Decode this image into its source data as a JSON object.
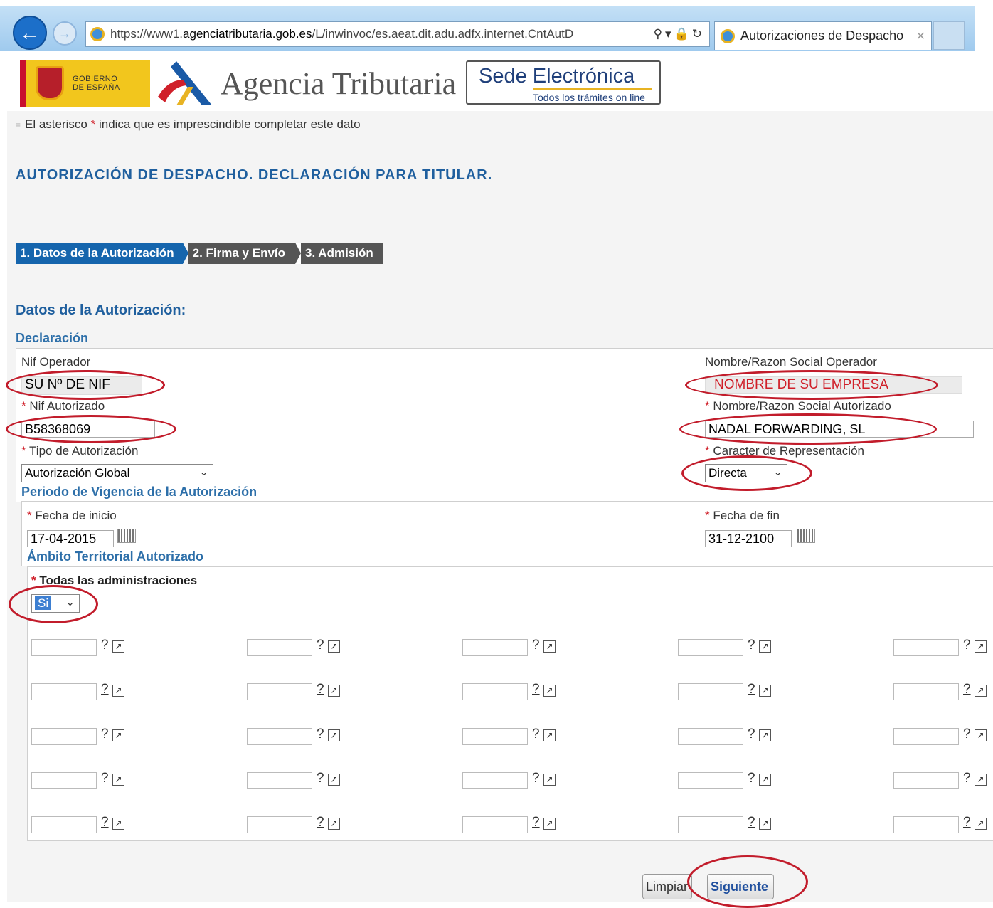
{
  "browser": {
    "url_prefix": "https://www1.",
    "url_domain": "agenciatributaria.gob.es",
    "url_rest": "/L/inwinvoc/es.aeat.dit.adu.adfx.internet.CntAutD",
    "tab_title": "Autorizaciones de Despacho"
  },
  "header": {
    "gov_line1": "GOBIERNO",
    "gov_line2": "DE ESPAÑA",
    "agency_name": "Agencia Tributaria",
    "sede_title": "Sede Electrónica",
    "sede_subtitle": "Todos los trámites on line"
  },
  "note": {
    "before": "El asterisco ",
    "star": "*",
    "after": " indica que es imprescindible completar este dato"
  },
  "page_title": "AUTORIZACIÓN DE DESPACHO. DECLARACIÓN PARA TITULAR.",
  "steps": [
    {
      "label": "1. Datos de la Autorización",
      "active": true
    },
    {
      "label": "2. Firma y Envío",
      "active": false
    },
    {
      "label": "3. Admisión",
      "active": false
    }
  ],
  "section_title": "Datos de la Autorización:",
  "declaracion": {
    "title": "Declaración",
    "nif_operador_label": "Nif Operador",
    "nif_operador_value": "SU Nº DE NIF",
    "nombre_operador_label": "Nombre/Razon Social Operador",
    "nombre_operador_value": "NOMBRE DE SU EMPRESA",
    "nif_autorizado_label": "Nif Autorizado",
    "nif_autorizado_value": "B58368069",
    "nombre_autorizado_label": "Nombre/Razon Social Autorizado",
    "nombre_autorizado_value": "NADAL FORWARDING, SL",
    "tipo_label": "Tipo de Autorización",
    "tipo_value": "Autorización Global",
    "caracter_label": "Caracter de Representación",
    "caracter_value": "Directa"
  },
  "periodo": {
    "title": "Periodo de Vigencia de la Autorización",
    "inicio_label": "Fecha de inicio",
    "inicio_value": "17-04-2015",
    "fin_label": "Fecha de fin",
    "fin_value": "31-12-2100"
  },
  "ambito": {
    "title": "Ámbito Territorial Autorizado",
    "todas_label": "Todas las administraciones",
    "todas_value": "Si",
    "help_glyph": "?",
    "popup_glyph": "↗"
  },
  "buttons": {
    "limpiar": "Limpiar",
    "siguiente": "Siguiente"
  },
  "colors": {
    "accent_blue": "#1f5f9e",
    "step_active": "#1565ad",
    "annotation_red": "#c21c2b"
  }
}
